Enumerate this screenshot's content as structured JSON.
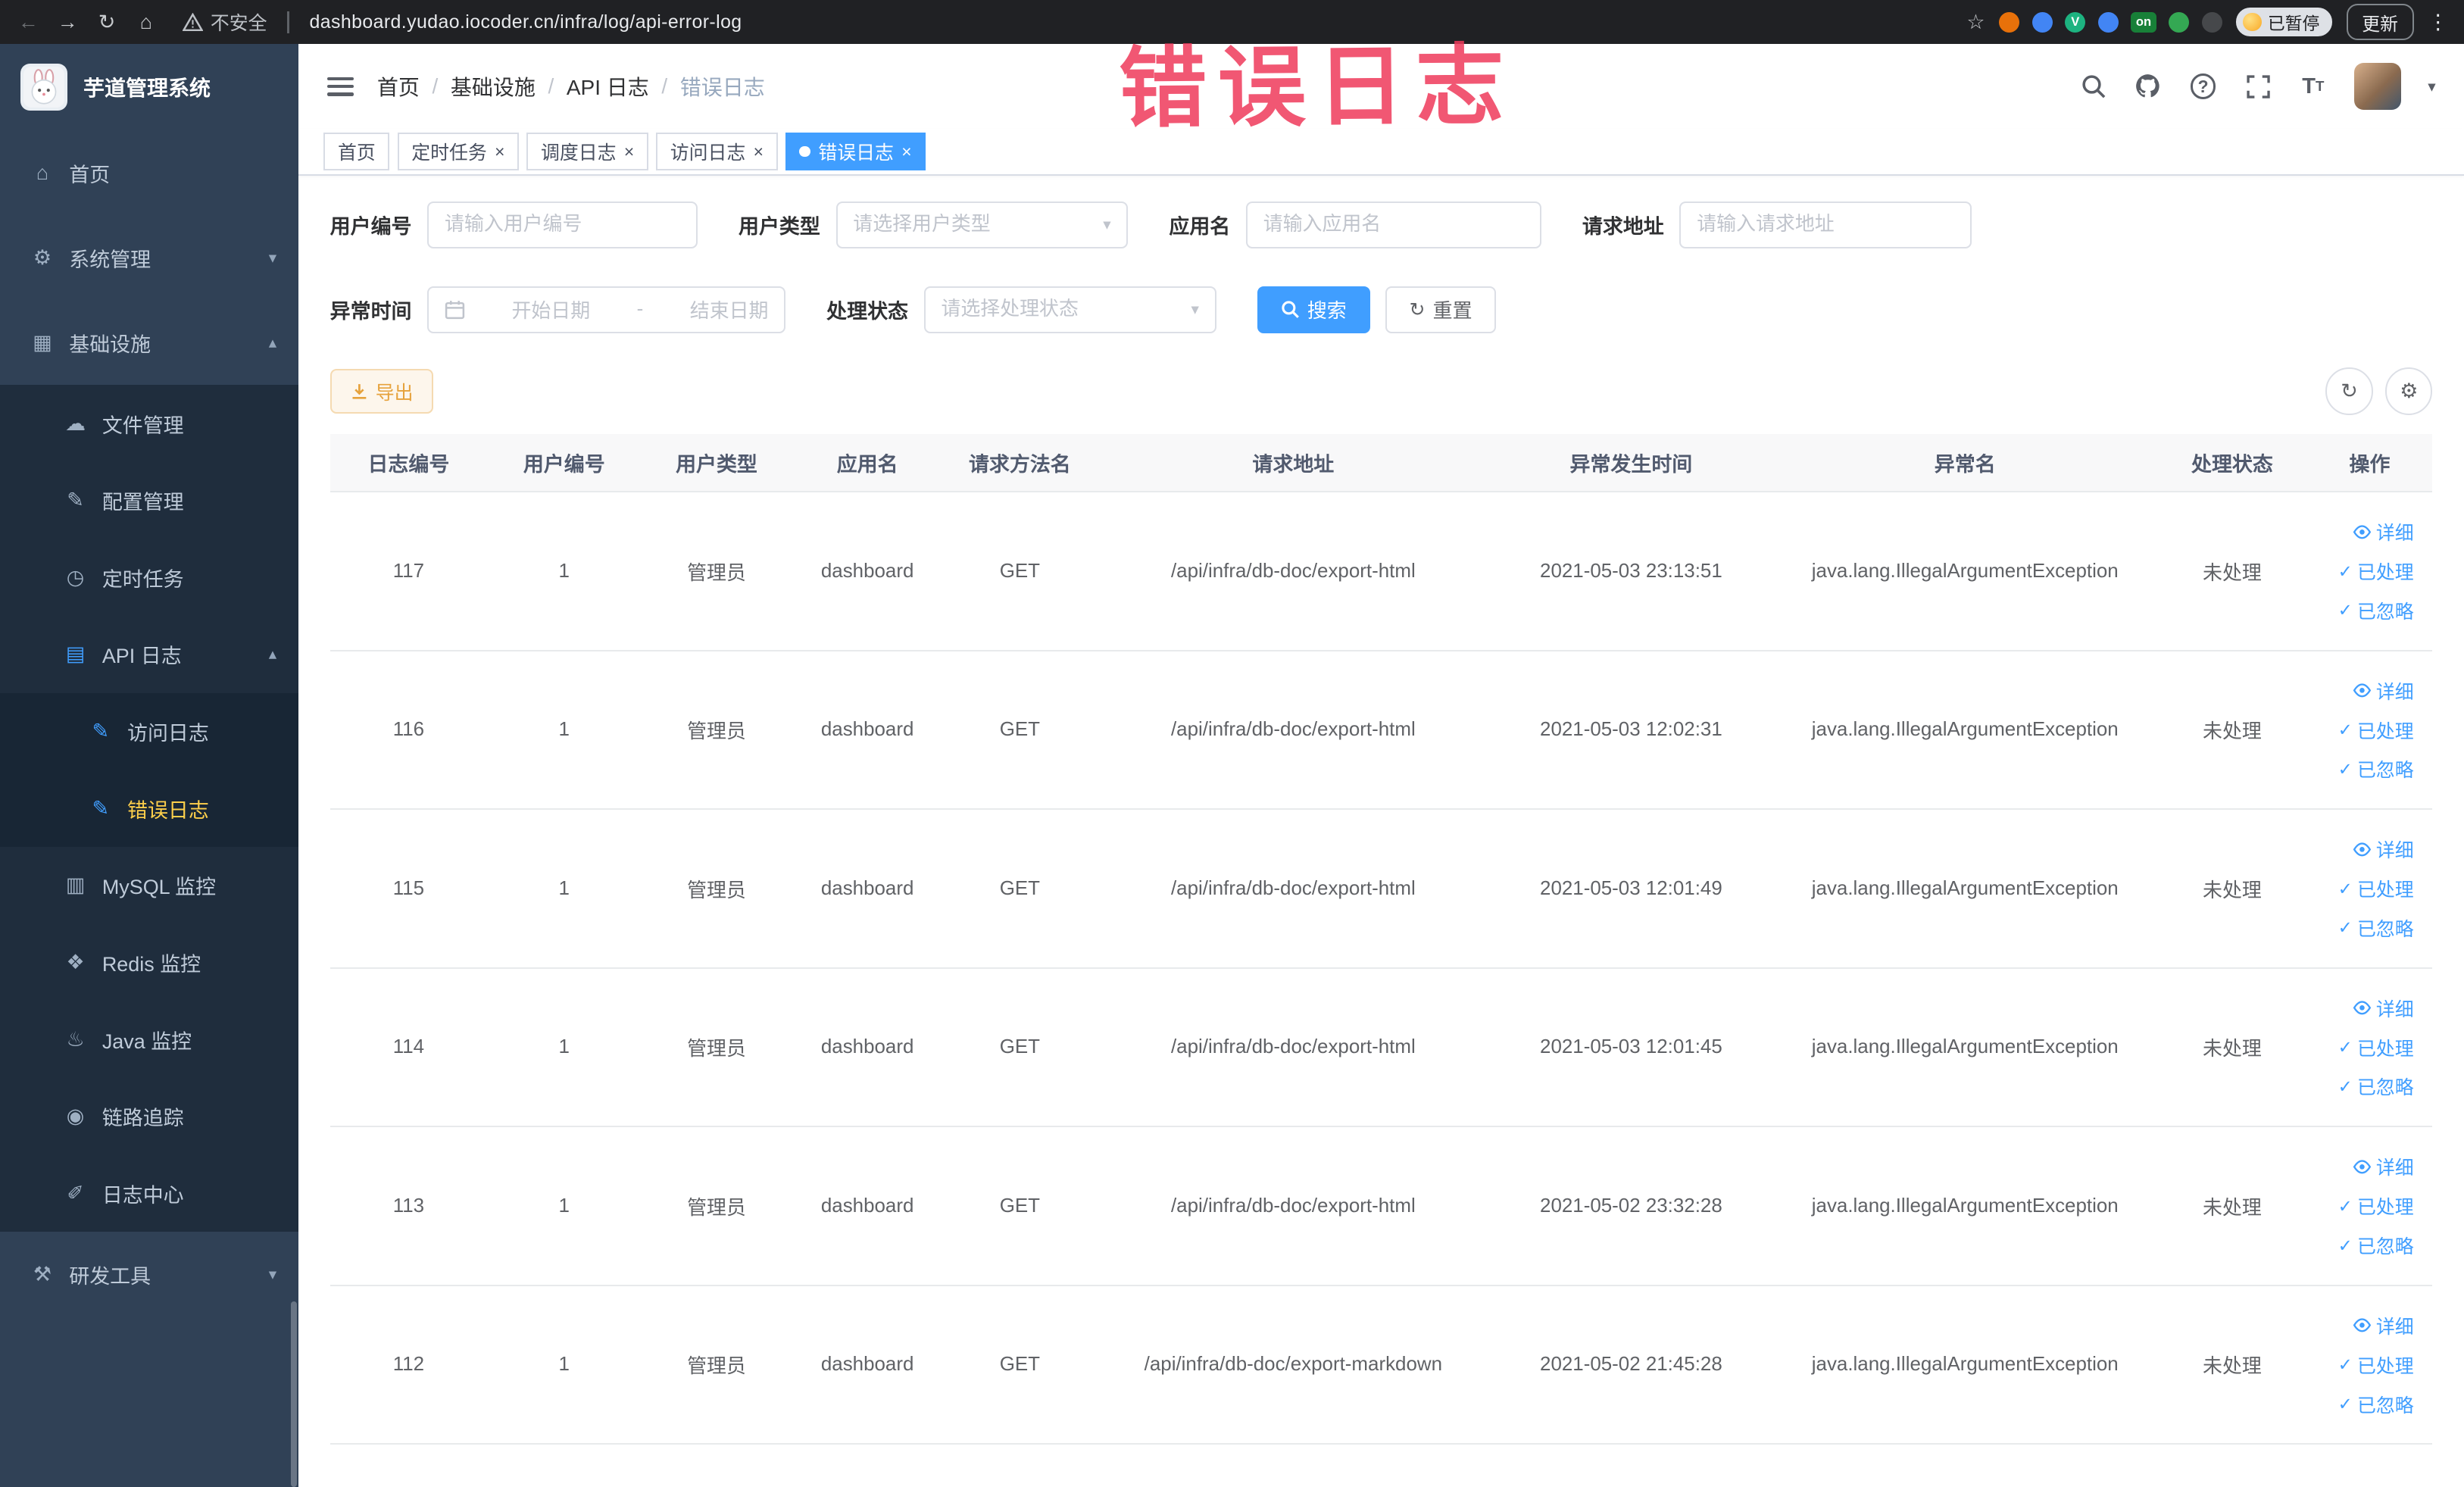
{
  "browser": {
    "security_label": "不安全",
    "url": "dashboard.yudao.iocoder.cn/infra/log/api-error-log",
    "paused_badge": "已暂停",
    "update_button": "更新",
    "extensions": [
      {
        "name": "adblock-extension-icon",
        "color": "#e8710a",
        "label": "",
        "shape": "round"
      },
      {
        "name": "waterdrop-extension-icon",
        "color": "#4285f4",
        "label": "",
        "shape": "round"
      },
      {
        "name": "v-extension-icon",
        "color": "#1db380",
        "label": "V",
        "shape": "round"
      },
      {
        "name": "grid-extension-icon",
        "color": "#4285f4",
        "label": "",
        "shape": "round"
      },
      {
        "name": "on-extension-icon",
        "color": "#188038",
        "label": "on",
        "shape": "square"
      },
      {
        "name": "leaf-extension-icon",
        "color": "#34a853",
        "label": "",
        "shape": "round"
      },
      {
        "name": "paw-extension-icon",
        "color": "#46484b",
        "label": "",
        "shape": "round"
      }
    ]
  },
  "annotation": {
    "text": "错误日志"
  },
  "sidebar": {
    "title": "芋道管理系统",
    "items": [
      {
        "label": "首页",
        "icon": "home",
        "level": 0
      },
      {
        "label": "系统管理",
        "icon": "gear",
        "level": 0,
        "chevron": "down"
      },
      {
        "label": "基础设施",
        "icon": "grid",
        "level": 0,
        "chevron": "up"
      },
      {
        "label": "文件管理",
        "icon": "cloud",
        "level": 1
      },
      {
        "label": "配置管理",
        "icon": "edit",
        "level": 1
      },
      {
        "label": "定时任务",
        "icon": "clock",
        "level": 1
      },
      {
        "label": "API 日志",
        "icon": "apilog",
        "level": 1,
        "chevron": "up",
        "blue": true
      },
      {
        "label": "访问日志",
        "icon": "log",
        "level": 2,
        "blue": true
      },
      {
        "label": "错误日志",
        "icon": "log",
        "level": 2,
        "blue": true,
        "active": true
      },
      {
        "label": "MySQL 监控",
        "icon": "mysql",
        "level": 1
      },
      {
        "label": "Redis 监控",
        "icon": "redis",
        "level": 1
      },
      {
        "label": "Java 监控",
        "icon": "java",
        "level": 1
      },
      {
        "label": "链路追踪",
        "icon": "eye",
        "level": 1
      },
      {
        "label": "日志中心",
        "icon": "logcenter",
        "level": 1
      },
      {
        "label": "研发工具",
        "icon": "tools",
        "level": 0,
        "chevron": "down"
      }
    ]
  },
  "header": {
    "breadcrumbs": [
      "首页",
      "基础设施",
      "API 日志",
      "错误日志"
    ]
  },
  "tabs": [
    {
      "label": "首页",
      "closable": false,
      "active": false
    },
    {
      "label": "定时任务",
      "closable": true,
      "active": false
    },
    {
      "label": "调度日志",
      "closable": true,
      "active": false
    },
    {
      "label": "访问日志",
      "closable": true,
      "active": false
    },
    {
      "label": "错误日志",
      "closable": true,
      "active": true
    }
  ],
  "filters": {
    "user_id_label": "用户编号",
    "user_id_placeholder": "请输入用户编号",
    "user_type_label": "用户类型",
    "user_type_placeholder": "请选择用户类型",
    "app_name_label": "应用名",
    "app_name_placeholder": "请输入应用名",
    "request_url_label": "请求地址",
    "request_url_placeholder": "请输入请求地址",
    "exception_time_label": "异常时间",
    "date_start_placeholder": "开始日期",
    "date_separator": "-",
    "date_end_placeholder": "结束日期",
    "process_status_label": "处理状态",
    "process_status_placeholder": "请选择处理状态",
    "search_button": "搜索",
    "reset_button": "重置"
  },
  "toolbar": {
    "export_button": "导出"
  },
  "table": {
    "columns": [
      "日志编号",
      "用户编号",
      "用户类型",
      "应用名",
      "请求方法名",
      "请求地址",
      "异常发生时间",
      "异常名",
      "处理状态",
      "操作"
    ],
    "actions": [
      "详细",
      "已处理",
      "已忽略"
    ],
    "rows": [
      {
        "id": "117",
        "user_id": "1",
        "user_type": "管理员",
        "app": "dashboard",
        "method": "GET",
        "url": "/api/infra/db-doc/export-html",
        "time": "2021-05-03 23:13:51",
        "exception": "java.lang.IllegalArgumentException",
        "status": "未处理"
      },
      {
        "id": "116",
        "user_id": "1",
        "user_type": "管理员",
        "app": "dashboard",
        "method": "GET",
        "url": "/api/infra/db-doc/export-html",
        "time": "2021-05-03 12:02:31",
        "exception": "java.lang.IllegalArgumentException",
        "status": "未处理"
      },
      {
        "id": "115",
        "user_id": "1",
        "user_type": "管理员",
        "app": "dashboard",
        "method": "GET",
        "url": "/api/infra/db-doc/export-html",
        "time": "2021-05-03 12:01:49",
        "exception": "java.lang.IllegalArgumentException",
        "status": "未处理"
      },
      {
        "id": "114",
        "user_id": "1",
        "user_type": "管理员",
        "app": "dashboard",
        "method": "GET",
        "url": "/api/infra/db-doc/export-html",
        "time": "2021-05-03 12:01:45",
        "exception": "java.lang.IllegalArgumentException",
        "status": "未处理"
      },
      {
        "id": "113",
        "user_id": "1",
        "user_type": "管理员",
        "app": "dashboard",
        "method": "GET",
        "url": "/api/infra/db-doc/export-html",
        "time": "2021-05-02 23:32:28",
        "exception": "java.lang.IllegalArgumentException",
        "status": "未处理"
      },
      {
        "id": "112",
        "user_id": "1",
        "user_type": "管理员",
        "app": "dashboard",
        "method": "GET",
        "url": "/api/infra/db-doc/export-markdown",
        "time": "2021-05-02 21:45:28",
        "exception": "java.lang.IllegalArgumentException",
        "status": "未处理"
      }
    ]
  }
}
